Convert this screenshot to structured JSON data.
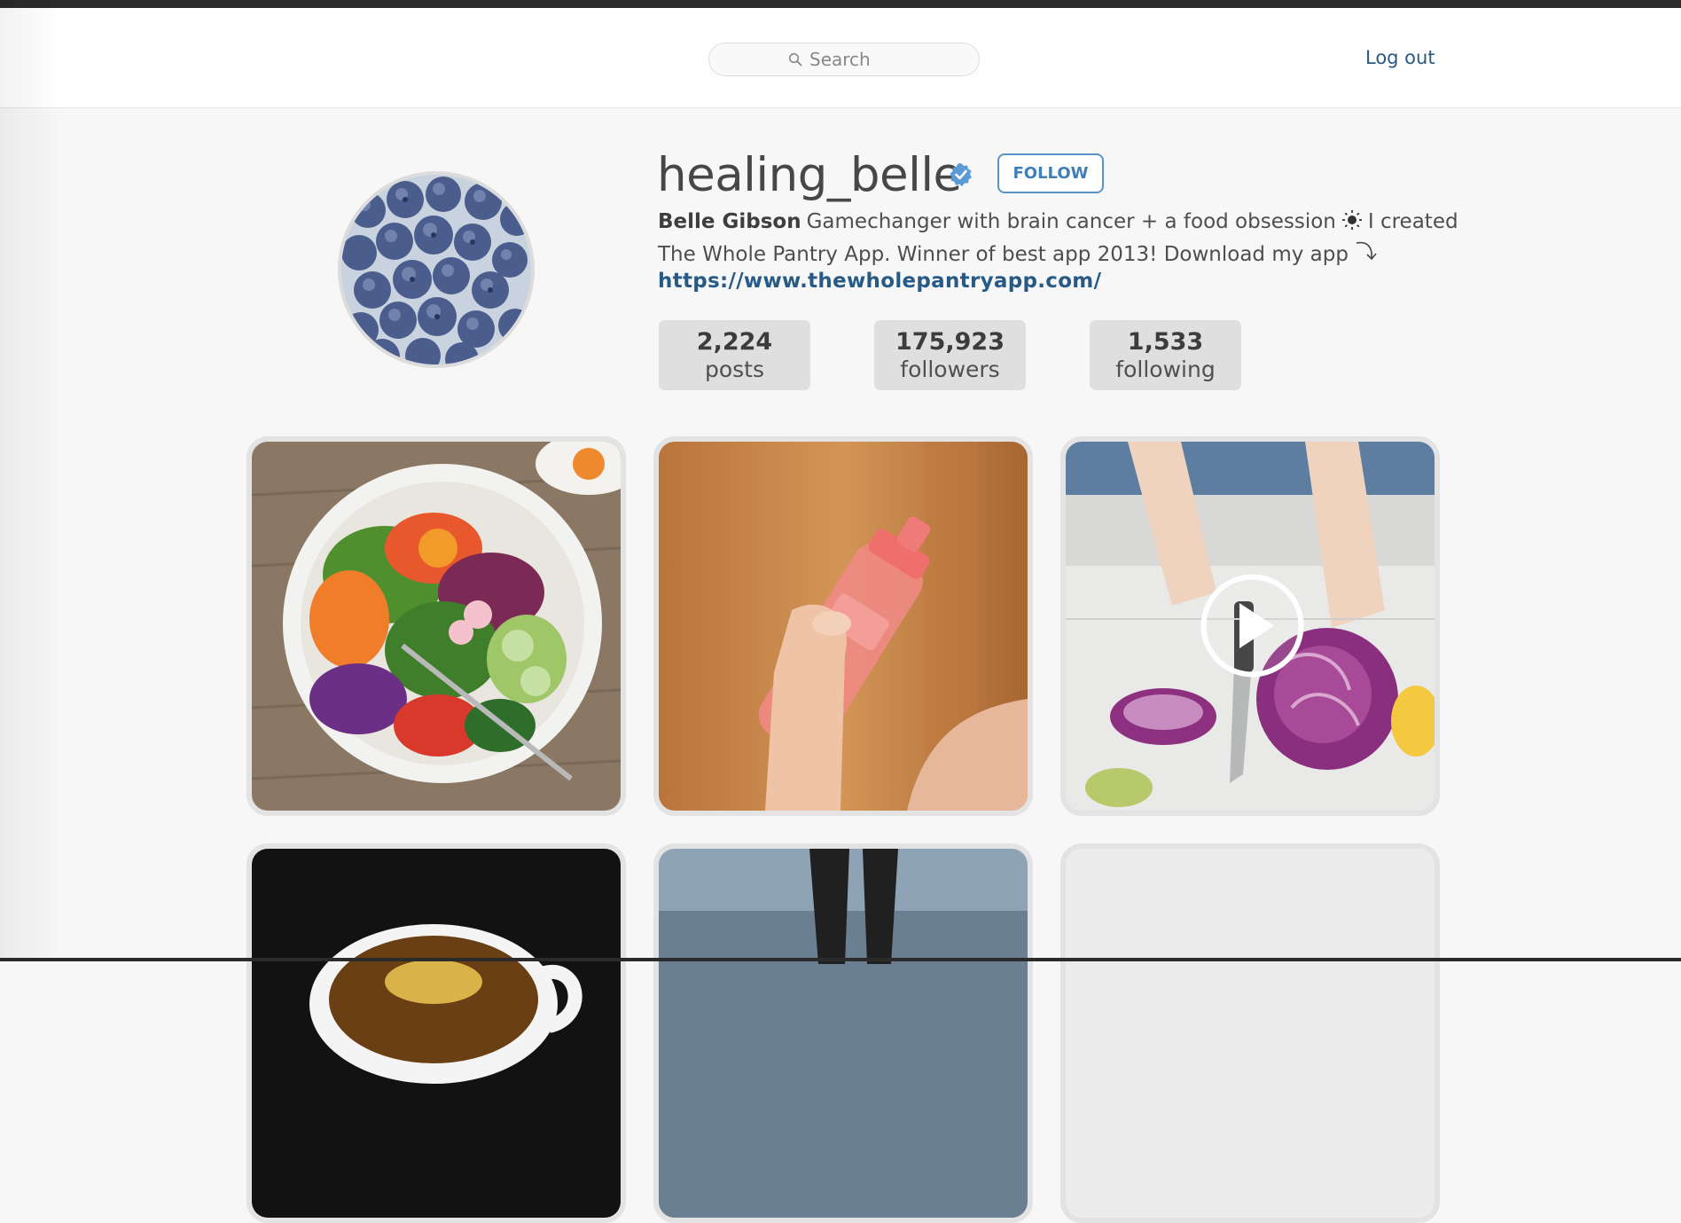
{
  "header": {
    "search": {
      "placeholder": "Search",
      "icon": "search-icon"
    },
    "logout_label": "Log out"
  },
  "profile": {
    "username": "healing_belle",
    "verified_icon": "verified-badge-icon",
    "follow_label": "FOLLOW",
    "display_name": "Belle Gibson",
    "bio_line1": "Gamechanger with brain cancer + a food obsession",
    "bio_line1_end": "I created",
    "bio_line2": "The Whole Pantry App. Winner of best app 2013! Download my app",
    "bio_icons": [
      "sun-icon",
      "curved-arrow-icon"
    ],
    "link": "https://www.thewholepantryapp.com/"
  },
  "stats": [
    {
      "value": "2,224",
      "label": "posts"
    },
    {
      "value": "175,923",
      "label": "followers"
    },
    {
      "value": "1,533",
      "label": "following"
    }
  ],
  "grid": {
    "posts": [
      {
        "subject": "salad bowl"
      },
      {
        "subject": "pink water bottle"
      },
      {
        "subject": "cutting red cabbage",
        "video": true,
        "icon": "play-icon"
      },
      {
        "subject": "tea cup with lemon"
      },
      {
        "subject": "person walking"
      },
      {
        "subject": "blank"
      }
    ]
  },
  "colors": {
    "accent": "#3f7fb7",
    "link": "#275a85",
    "verified": "#5b9bd5",
    "stat_bg": "#e0dfdf"
  }
}
